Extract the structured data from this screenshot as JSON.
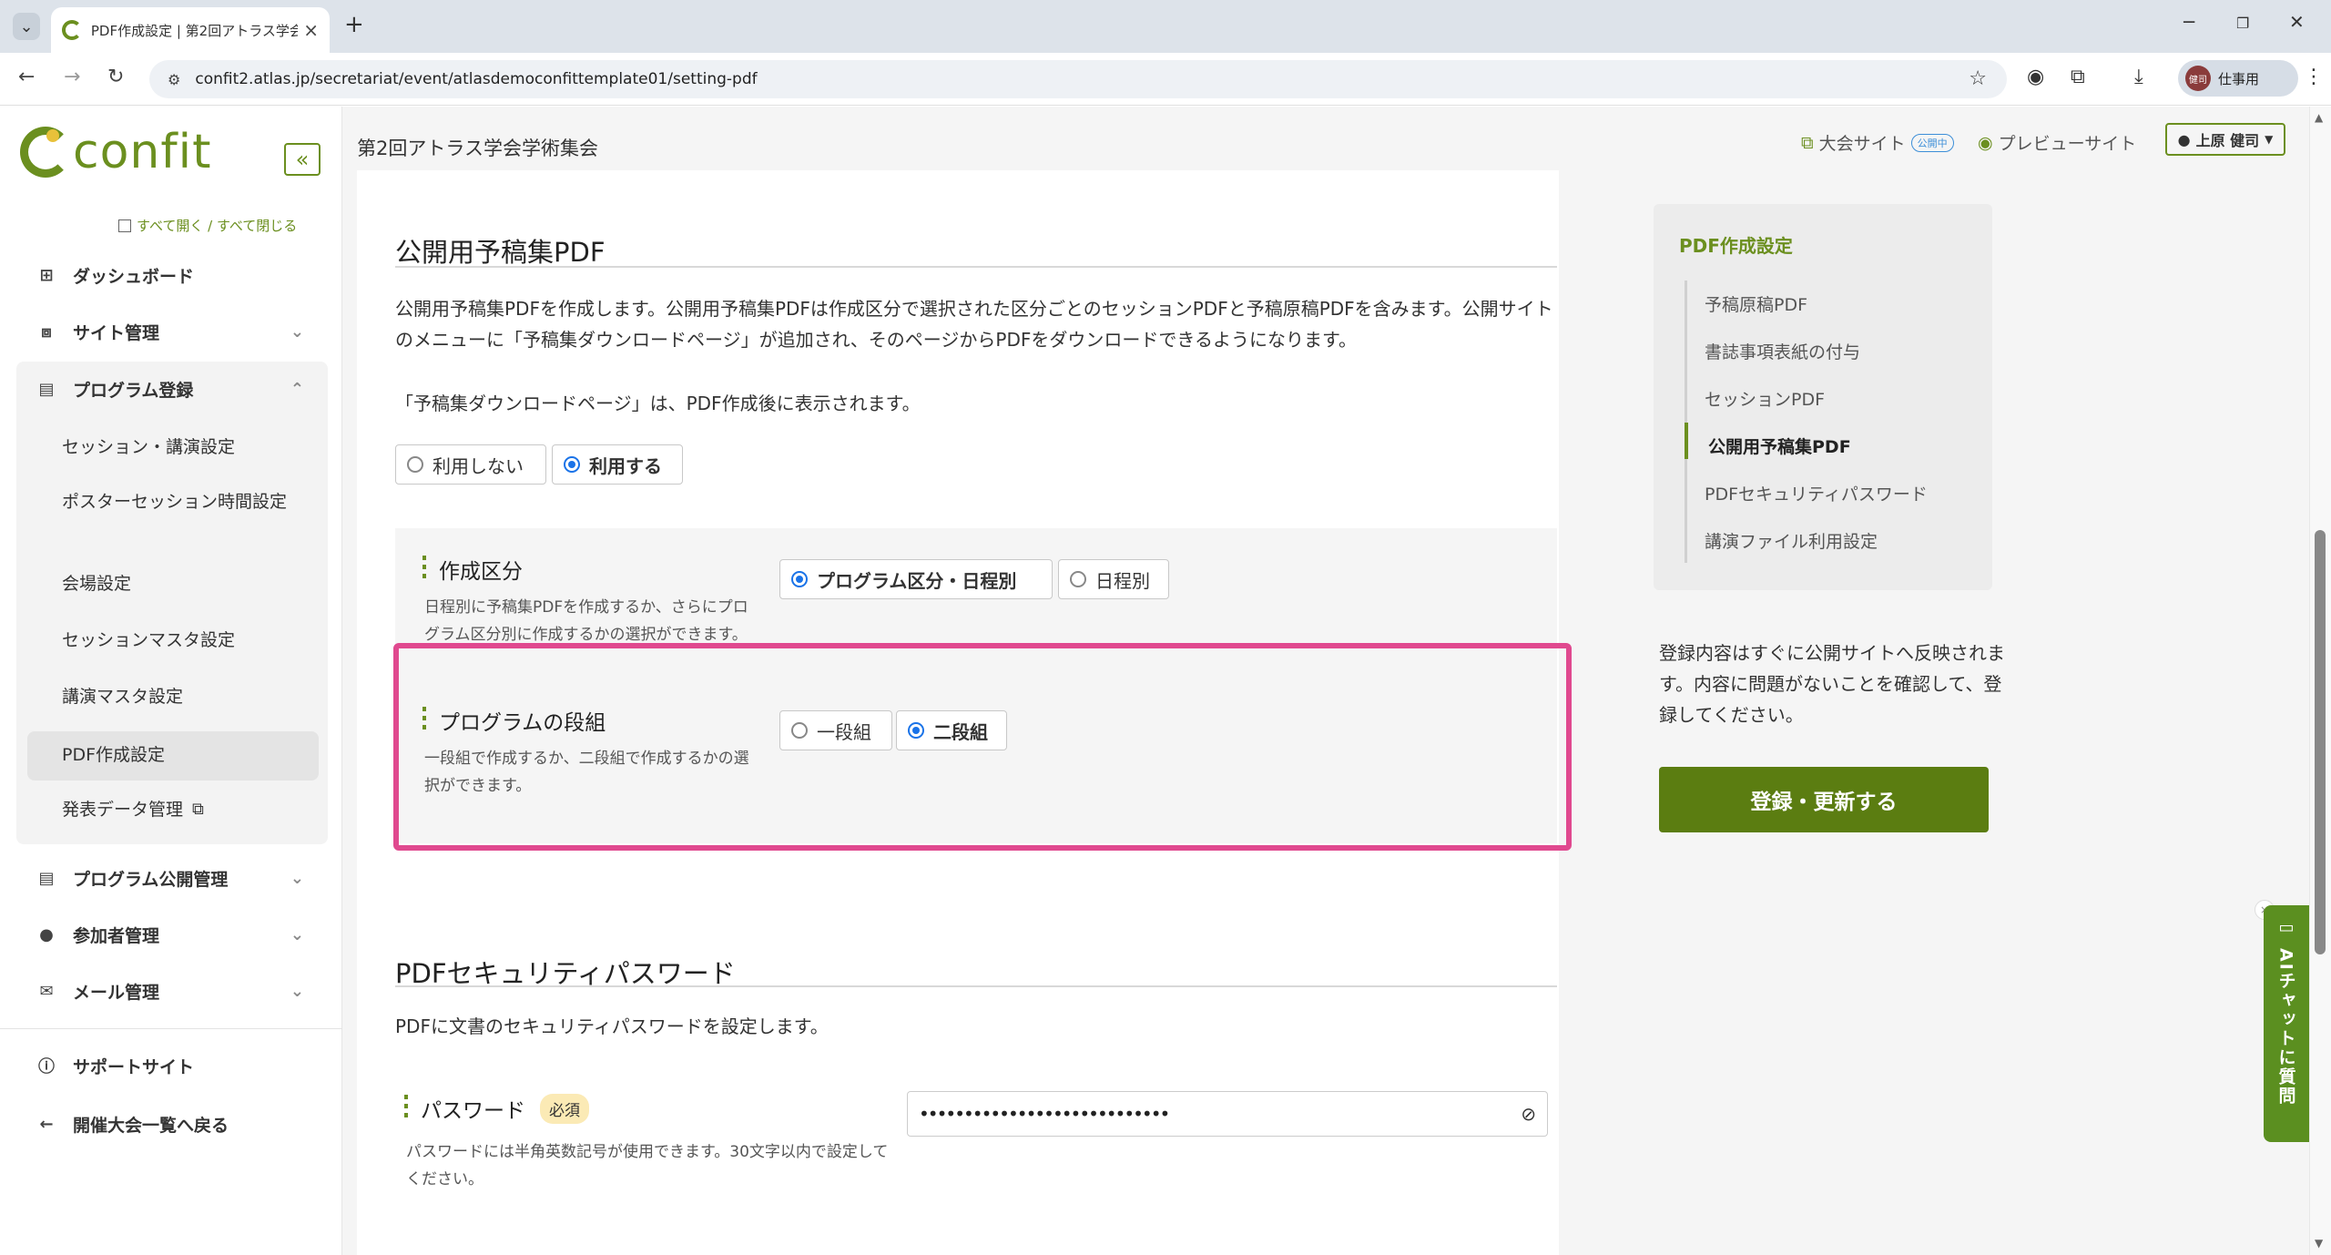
{
  "browser": {
    "tab_title": "PDF作成設定 | 第2回アトラス学会",
    "url": "confit2.atlas.jp/secretariat/event/atlasdemoconfittemplate01/setting-pdf",
    "profile_label": "仕事用",
    "profile_avatar": "健司"
  },
  "sidebar": {
    "logo_text": "confit",
    "expand_all": "すべて開く / すべて閉じる",
    "items": [
      {
        "label": "ダッシュボード"
      },
      {
        "label": "サイト管理"
      },
      {
        "label": "プログラム登録"
      },
      {
        "label": "プログラム公開管理"
      },
      {
        "label": "参加者管理"
      },
      {
        "label": "メール管理"
      },
      {
        "label": "サポートサイト"
      },
      {
        "label": "開催大会一覧へ戻る"
      }
    ],
    "subitems": [
      {
        "label": "セッション・講演設定"
      },
      {
        "label": "ポスターセッション時間設定"
      },
      {
        "label": "会場設定"
      },
      {
        "label": "セッションマスタ設定"
      },
      {
        "label": "講演マスタ設定"
      },
      {
        "label": "PDF作成設定"
      },
      {
        "label": "発表データ管理"
      }
    ]
  },
  "header": {
    "event_title": "第2回アトラス学会学術集会",
    "site_link": "大会サイト",
    "site_badge": "公開中",
    "preview_link": "プレビューサイト",
    "user_name": "上原 健司"
  },
  "sections": {
    "public_pdf": {
      "title": "公開用予稿集PDF",
      "desc": "公開用予稿集PDFを作成します。公開用予稿集PDFは作成区分で選択された区分ごとのセッションPDFと予稿原稿PDFを含みます。公開サイトのメニューに「予稿集ダウンロードページ」が追加され、そのページからPDFをダウンロードできるようになります。",
      "note": "「予稿集ダウンロードページ」は、PDF作成後に表示されます。",
      "use_no": "利用しない",
      "use_yes": "利用する",
      "division_label": "作成区分",
      "division_desc": "日程別に予稿集PDFを作成するか、さらにプログラム区分別に作成するかの選択ができます。",
      "division_opt1": "プログラム区分・日程別",
      "division_opt2": "日程別",
      "column_label": "プログラムの段組",
      "column_desc": "一段組で作成するか、二段組で作成するかの選択ができます。",
      "column_opt1": "一段組",
      "column_opt2": "二段組"
    },
    "security": {
      "title": "PDFセキュリティパスワード",
      "desc": "PDFに文書のセキュリティパスワードを設定します。",
      "password_label": "パスワード",
      "required": "必須",
      "password_help": "パスワードには半角英数記号が使用できます。30文字以内で設定してください。",
      "password_value": "••••••••••••••••••••••••••••"
    }
  },
  "toc": {
    "title": "PDF作成設定",
    "items": [
      {
        "label": "予稿原稿PDF"
      },
      {
        "label": "書誌事項表紙の付与"
      },
      {
        "label": "セッションPDF"
      },
      {
        "label": "公開用予稿集PDF"
      },
      {
        "label": "PDFセキュリティパスワード"
      },
      {
        "label": "講演ファイル利用設定"
      }
    ]
  },
  "notice": "登録内容はすぐに公開サイトへ反映されます。内容に問題がないことを確認して、登録してください。",
  "submit_label": "登録・更新する",
  "ai_chat_label": "AIチャットに質問"
}
